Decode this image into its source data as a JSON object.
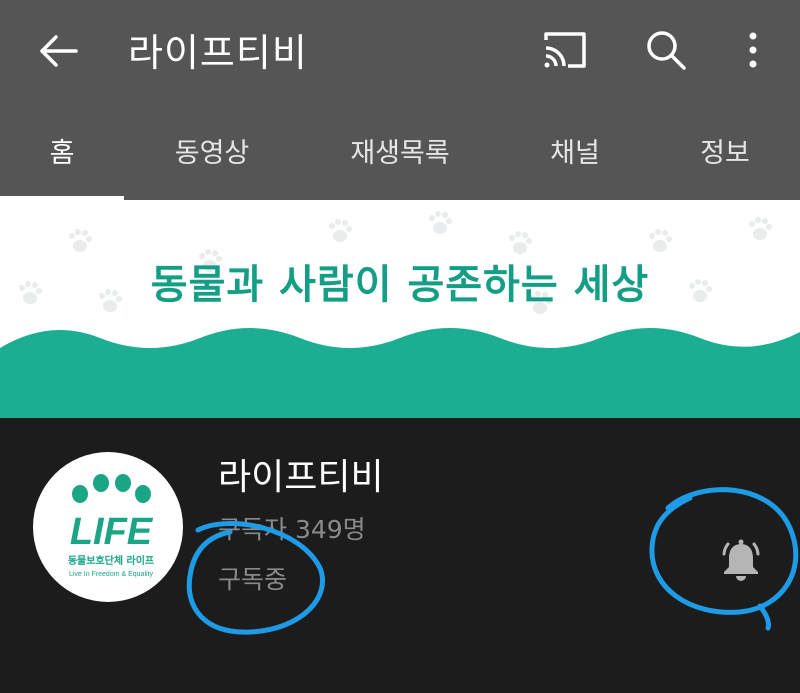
{
  "header": {
    "title": "라이프티비",
    "icons": [
      "back-arrow-icon",
      "cast-icon",
      "search-icon",
      "more-vert-icon"
    ]
  },
  "tabs": [
    {
      "label": "홈",
      "active": true
    },
    {
      "label": "동영상",
      "active": false
    },
    {
      "label": "재생목록",
      "active": false
    },
    {
      "label": "채널",
      "active": false
    },
    {
      "label": "정보",
      "active": false
    }
  ],
  "banner": {
    "slogan": "동물과 사람이 공존하는 세상"
  },
  "channel": {
    "name": "라이프티비",
    "subscribers": "구독자 349명",
    "status": "구독중",
    "logo": {
      "mark": "LIFE",
      "org_name": "동물보호단체 라이프",
      "tagline": "Live In Freedom & Equality"
    },
    "notification_icon": "bell-icon"
  },
  "colors": {
    "app_bar": "#555555",
    "background": "#1c1c1c",
    "brand_teal": "#159e86",
    "annotation_blue": "#1e9be6"
  }
}
